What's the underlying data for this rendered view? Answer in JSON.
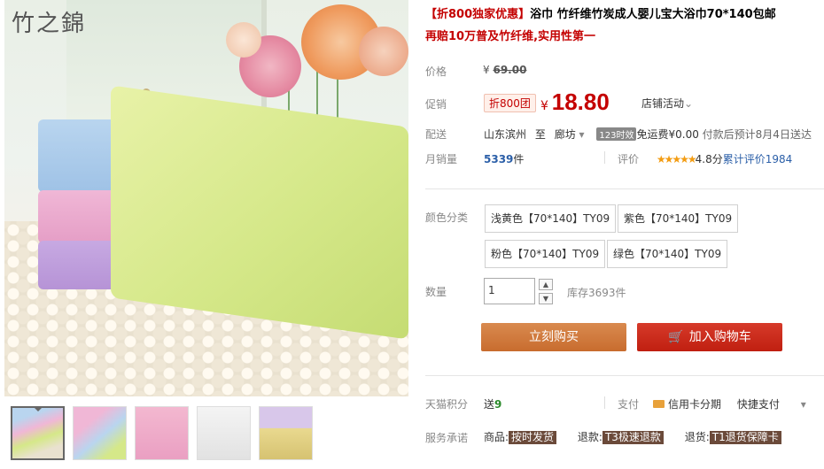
{
  "gallery": {
    "logo_text": "竹之錦",
    "thumbnails": [
      "thumb-1",
      "thumb-2",
      "thumb-3",
      "thumb-4",
      "thumb-5"
    ]
  },
  "product": {
    "title_promo": "【折800独家优惠】",
    "title_main": "浴巾 竹纤维竹炭成人婴儿宝大浴巾70*140包邮",
    "subtitle": "再赔10万普及竹纤维,实用性第一"
  },
  "price": {
    "label": "价格",
    "currency": "¥",
    "original": "69.00"
  },
  "promo": {
    "label": "促销",
    "badge": "折800团",
    "currency": "¥",
    "price": "18.80",
    "shop_activity": "店铺活动"
  },
  "delivery": {
    "label": "配送",
    "from": "山东滨州",
    "to_word": "至",
    "destination": "廊坊",
    "tag": "123时效",
    "shipping_fee": "免运费¥0.00",
    "eta": "付款后预计8月4日送达"
  },
  "sales": {
    "label": "月销量",
    "count": "5339",
    "unit": "件"
  },
  "review": {
    "label": "评价",
    "stars": "★★★★★",
    "score": "4.8分",
    "total_label": "累计评价",
    "total": "1984"
  },
  "color": {
    "label": "颜色分类",
    "options": [
      "浅黄色【70*140】TY09",
      "紫色【70*140】TY09",
      "粉色【70*140】TY09",
      "绿色【70*140】TY09"
    ]
  },
  "quantity": {
    "label": "数量",
    "value": "1",
    "stock": "库存3693件"
  },
  "actions": {
    "buy_now": "立刻购买",
    "add_cart": "加入购物车"
  },
  "points": {
    "label": "天猫积分",
    "send": "送",
    "value": "9"
  },
  "payment": {
    "label": "支付",
    "credit": "信用卡分期",
    "quick": "快捷支付"
  },
  "service": {
    "label": "服务承诺",
    "goods_label": "商品:",
    "goods_chip": "按时发货",
    "refund_label": "退款:",
    "refund_chip": "T3极速退款",
    "return_label": "退货:",
    "return_chip": "T1退货保障卡"
  },
  "colors": {
    "accent_red": "#c40000",
    "buy_orange": "#c86c2e",
    "cart_red": "#c01f10",
    "link_blue": "#2b5fa8"
  }
}
